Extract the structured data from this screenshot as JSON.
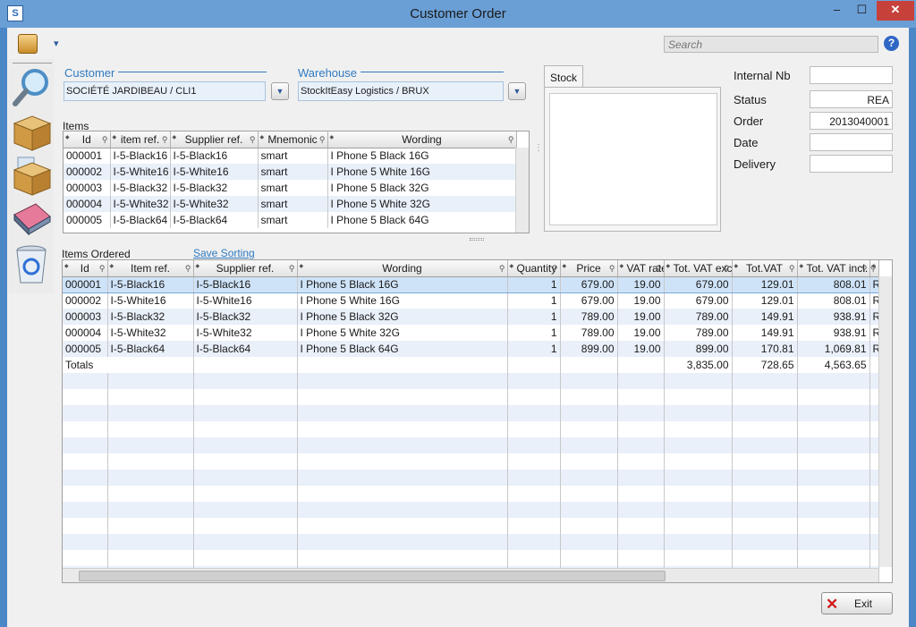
{
  "window": {
    "title": "Customer Order",
    "app_icon": "S",
    "minimize": "–",
    "maximize": "☐",
    "close": "✕"
  },
  "toolbar": {
    "search_placeholder": "Search",
    "dropdown_glyph": "▾",
    "help_glyph": "?"
  },
  "sidebar": {
    "icons": [
      "magnifier-icon",
      "box-icon",
      "box-edit-icon",
      "eraser-icon",
      "recycle-bin-icon"
    ]
  },
  "customer": {
    "label": "Customer",
    "value": "SOCIÉTÉ JARDIBEAU / CLI1"
  },
  "warehouse": {
    "label": "Warehouse",
    "value": "StockItEasy Logistics / BRUX"
  },
  "stock": {
    "tab_label": "Stock"
  },
  "info": {
    "internal_nb": {
      "label": "Internal Nb",
      "value": ""
    },
    "status": {
      "label": "Status",
      "value": "REA"
    },
    "order": {
      "label": "Order",
      "value": "2013040001"
    },
    "date": {
      "label": "Date",
      "value": ""
    },
    "delivery": {
      "label": "Delivery",
      "value": ""
    }
  },
  "items": {
    "label": "Items",
    "columns": [
      "Id",
      "item ref.",
      "Supplier ref.",
      "Mnemonic",
      "Wording"
    ],
    "rows": [
      [
        "000001",
        "I-5-Black16",
        "I-5-Black16",
        "smart",
        "I Phone 5 Black 16G"
      ],
      [
        "000002",
        "I-5-White16",
        "I-5-White16",
        "smart",
        "I Phone 5 White 16G"
      ],
      [
        "000003",
        "I-5-Black32",
        "I-5-Black32",
        "smart",
        "I Phone 5 Black 32G"
      ],
      [
        "000004",
        "I-5-White32",
        "I-5-White32",
        "smart",
        "I Phone 5 White 32G"
      ],
      [
        "000005",
        "I-5-Black64",
        "I-5-Black64",
        "smart",
        "I Phone 5 Black 64G"
      ]
    ]
  },
  "ordered": {
    "label": "Items Ordered",
    "save_sorting": "Save Sorting",
    "columns": [
      "Id",
      "Item ref.",
      "Supplier ref.",
      "Wording",
      "Quantity",
      "Price",
      "VAT rate",
      "Tot. VAT excl.",
      "Tot.VAT",
      "Tot. VAT incl."
    ],
    "rows": [
      [
        "000001",
        "I-5-Black16",
        "I-5-Black16",
        "I Phone 5 Black 16G",
        "1",
        "679.00",
        "19.00",
        "679.00",
        "129.01",
        "808.01",
        "R"
      ],
      [
        "000002",
        "I-5-White16",
        "I-5-White16",
        "I Phone 5 White 16G",
        "1",
        "679.00",
        "19.00",
        "679.00",
        "129.01",
        "808.01",
        "R"
      ],
      [
        "000003",
        "I-5-Black32",
        "I-5-Black32",
        "I Phone 5 Black 32G",
        "1",
        "789.00",
        "19.00",
        "789.00",
        "149.91",
        "938.91",
        "R"
      ],
      [
        "000004",
        "I-5-White32",
        "I-5-White32",
        "I Phone 5 White 32G",
        "1",
        "789.00",
        "19.00",
        "789.00",
        "149.91",
        "938.91",
        "R"
      ],
      [
        "000005",
        "I-5-Black64",
        "I-5-Black64",
        "I Phone 5 Black 64G",
        "1",
        "899.00",
        "19.00",
        "899.00",
        "170.81",
        "1,069.81",
        "R"
      ]
    ],
    "totals": {
      "label": "Totals",
      "excl": "3,835.00",
      "vat": "728.65",
      "incl": "4,563.65"
    }
  },
  "footer": {
    "exit_label": "Exit",
    "exit_glyph": "✕"
  }
}
